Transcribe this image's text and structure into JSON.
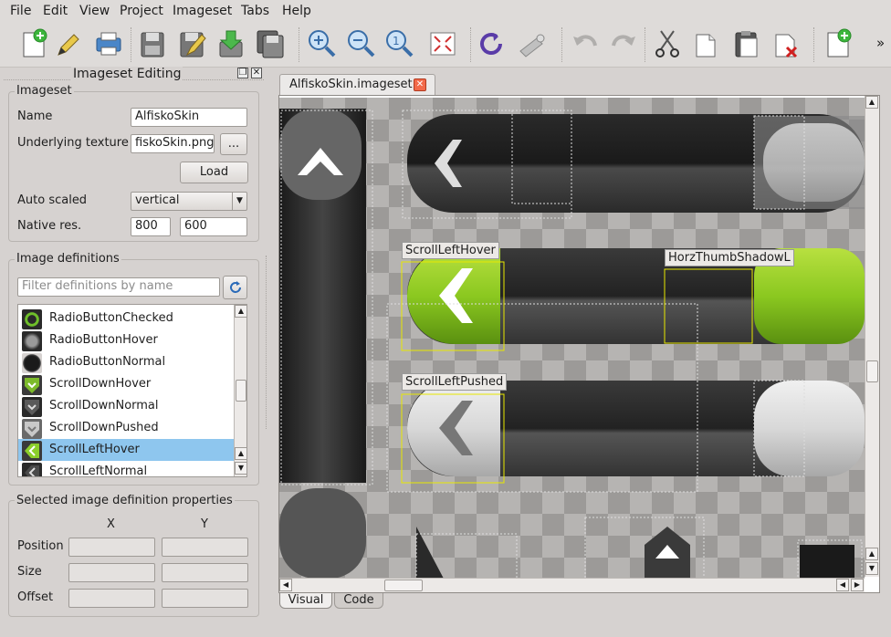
{
  "menu": [
    "File",
    "Edit",
    "View",
    "Project",
    "Imageset",
    "Tabs",
    "Help"
  ],
  "toolbar": {
    "icons": [
      "new-file-icon",
      "edit-pencil-icon",
      "print-icon",
      "save-icon",
      "save-as-icon",
      "import-icon",
      "save-all-icon",
      "zoom-in-icon",
      "zoom-out-icon",
      "zoom-reset-icon",
      "fit-icon",
      "refresh-icon",
      "settings-icon",
      "undo-icon",
      "redo-icon",
      "cut-icon",
      "copy-icon",
      "paste-icon",
      "delete-icon",
      "new-item-icon"
    ],
    "overflow": "»"
  },
  "dock": {
    "title": "Imageset Editing",
    "float_glyph": "❐",
    "close_glyph": "✕"
  },
  "imageset": {
    "group_title": "Imageset",
    "name_label": "Name",
    "name_value": "AlfiskoSkin",
    "texture_label": "Underlying texture",
    "texture_value": "fiskoSkin.png",
    "browse_label": "...",
    "load_label": "Load",
    "autoscaled_label": "Auto scaled",
    "autoscaled_value": "vertical",
    "native_label": "Native res.",
    "native_w": "800",
    "native_h": "600"
  },
  "definitions": {
    "group_title": "Image definitions",
    "filter_placeholder": "Filter definitions by name",
    "items": [
      {
        "label": "RadioButtonChecked",
        "color": "#6fbf2a",
        "selected": false
      },
      {
        "label": "RadioButtonHover",
        "color": "#7a7a7a",
        "selected": false
      },
      {
        "label": "RadioButtonNormal",
        "color": "#3a3a3a",
        "selected": false
      },
      {
        "label": "ScrollDownHover",
        "color": "#7cba2a",
        "selected": false
      },
      {
        "label": "ScrollDownNormal",
        "color": "#5a5a5a",
        "selected": false
      },
      {
        "label": "ScrollDownPushed",
        "color": "#b8b8b8",
        "selected": false
      },
      {
        "label": "ScrollLeftHover",
        "color": "#8bcf2a",
        "selected": true
      },
      {
        "label": "ScrollLeftNormal",
        "color": "#4a4a4a",
        "selected": false
      }
    ]
  },
  "properties": {
    "group_title": "Selected image definition properties",
    "col_x": "X",
    "col_y": "Y",
    "rows": [
      "Position",
      "Size",
      "Offset"
    ]
  },
  "editor": {
    "tab_label": "AlfiskoSkin.imageset",
    "labels": {
      "hover": "ScrollLeftHover",
      "thumb": "HorzThumbShadowL",
      "pushed": "ScrollLeftPushed"
    },
    "bottom_tabs": [
      "Visual",
      "Code"
    ]
  },
  "colors": {
    "selection": "#8ec6ee",
    "highlight_frame": "#e8e800",
    "accent_green": "#8bcf2a"
  }
}
